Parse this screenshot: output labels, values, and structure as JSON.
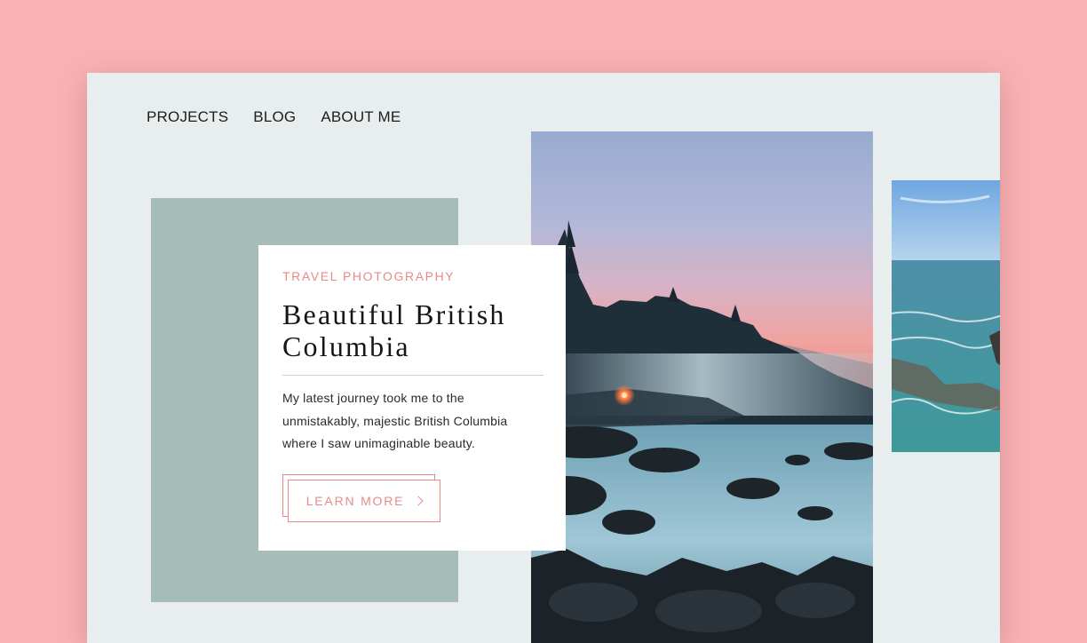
{
  "nav": {
    "items": [
      {
        "label": "PROJECTS"
      },
      {
        "label": "BLOG"
      },
      {
        "label": "ABOUT ME"
      }
    ]
  },
  "card": {
    "eyebrow": "TRAVEL PHOTOGRAPHY",
    "title_line1": "Beautiful British",
    "title_line2": "Columbia",
    "body": "My latest journey took me to the unmistakably, majestic British Columbia where I saw unimaginable beauty.",
    "button_label": "LEARN MORE"
  },
  "colors": {
    "background": "#f9b2b4",
    "page": "#e8eeee",
    "sage": "#a5bcb9",
    "accent": "#e88a88"
  },
  "icons": {
    "button_icon": "chevron-right-icon"
  }
}
